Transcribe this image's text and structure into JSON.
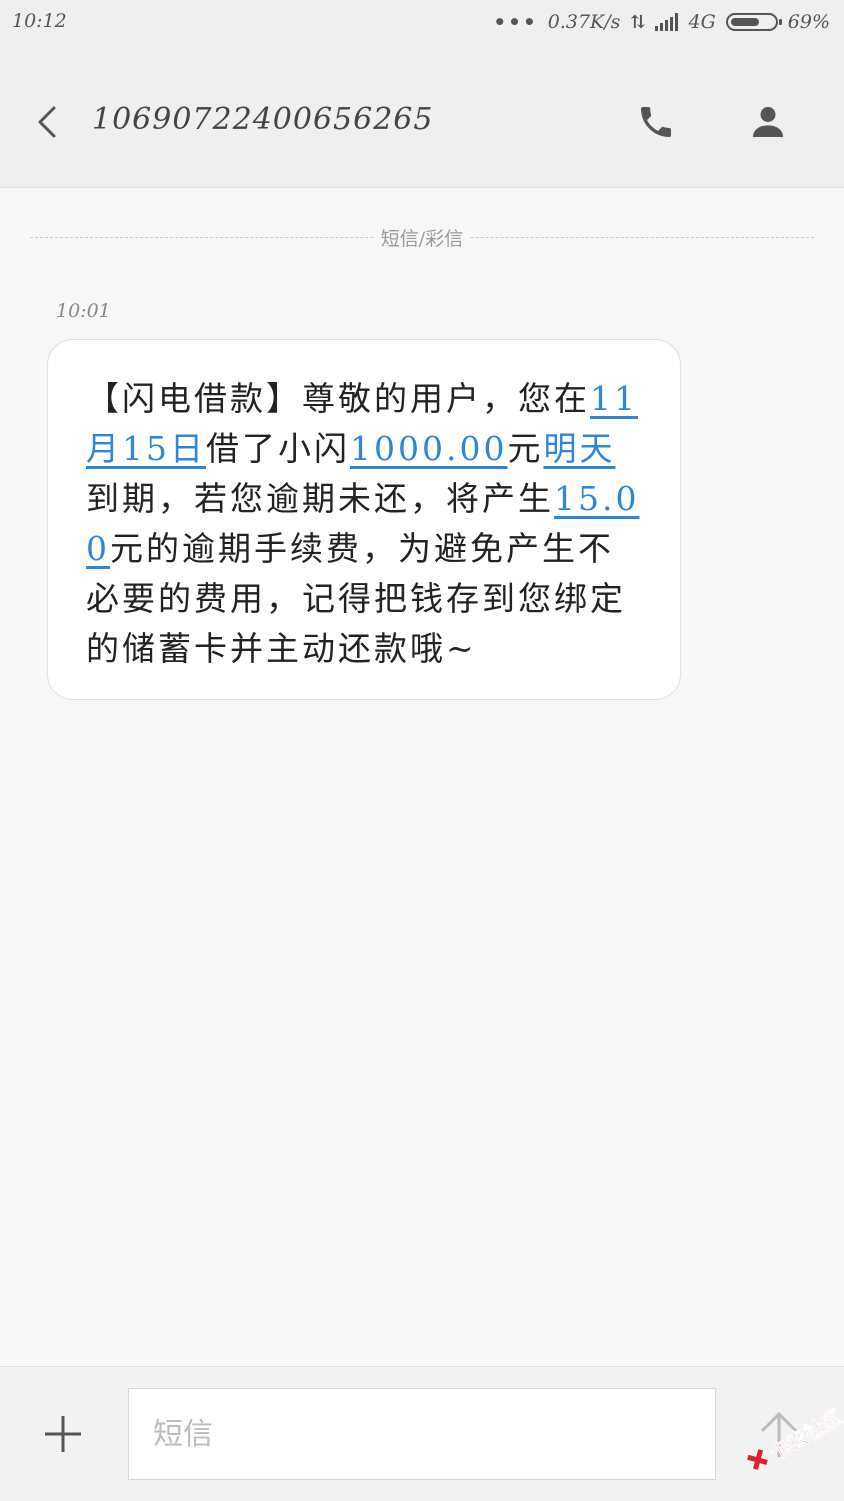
{
  "status_bar": {
    "time": "10:12",
    "more": "•••",
    "net_speed": "0.37K/s",
    "network_type": "4G",
    "battery_percent": "69%",
    "battery_level": 0.69,
    "icons": [
      "data-transfer-icon",
      "signal-icon",
      "battery-icon"
    ]
  },
  "header": {
    "contact_number": "10690722400656265",
    "icons": [
      "back-icon",
      "phone-icon",
      "contact-icon"
    ]
  },
  "conversation": {
    "divider_label": "短信/彩信",
    "messages": [
      {
        "time": "10:01",
        "parts": [
          {
            "text": "【闪电借款】尊敬的用户，您在",
            "link": false
          },
          {
            "text": "11月15日",
            "link": true
          },
          {
            "text": "借了小闪",
            "link": false
          },
          {
            "text": "1000.00",
            "link": true
          },
          {
            "text": "元",
            "link": false
          },
          {
            "text": "明天",
            "link": true
          },
          {
            "text": "到期，若您逾期未还，将产生",
            "link": false
          },
          {
            "text": "15.00",
            "link": true
          },
          {
            "text": "元的逾期手续费，为避免产生不必要的费用，记得把钱存到您绑定的储蓄卡并主动还款哦~",
            "link": false
          }
        ]
      }
    ]
  },
  "composer": {
    "placeholder": "短信",
    "icons": [
      "plus-icon",
      "send-icon"
    ]
  },
  "watermark": {
    "text": "卡农社区",
    "color": "#d9232e"
  },
  "colors": {
    "link": "#2f86d6",
    "background": "#f7f7f7",
    "bar": "#efefef"
  }
}
